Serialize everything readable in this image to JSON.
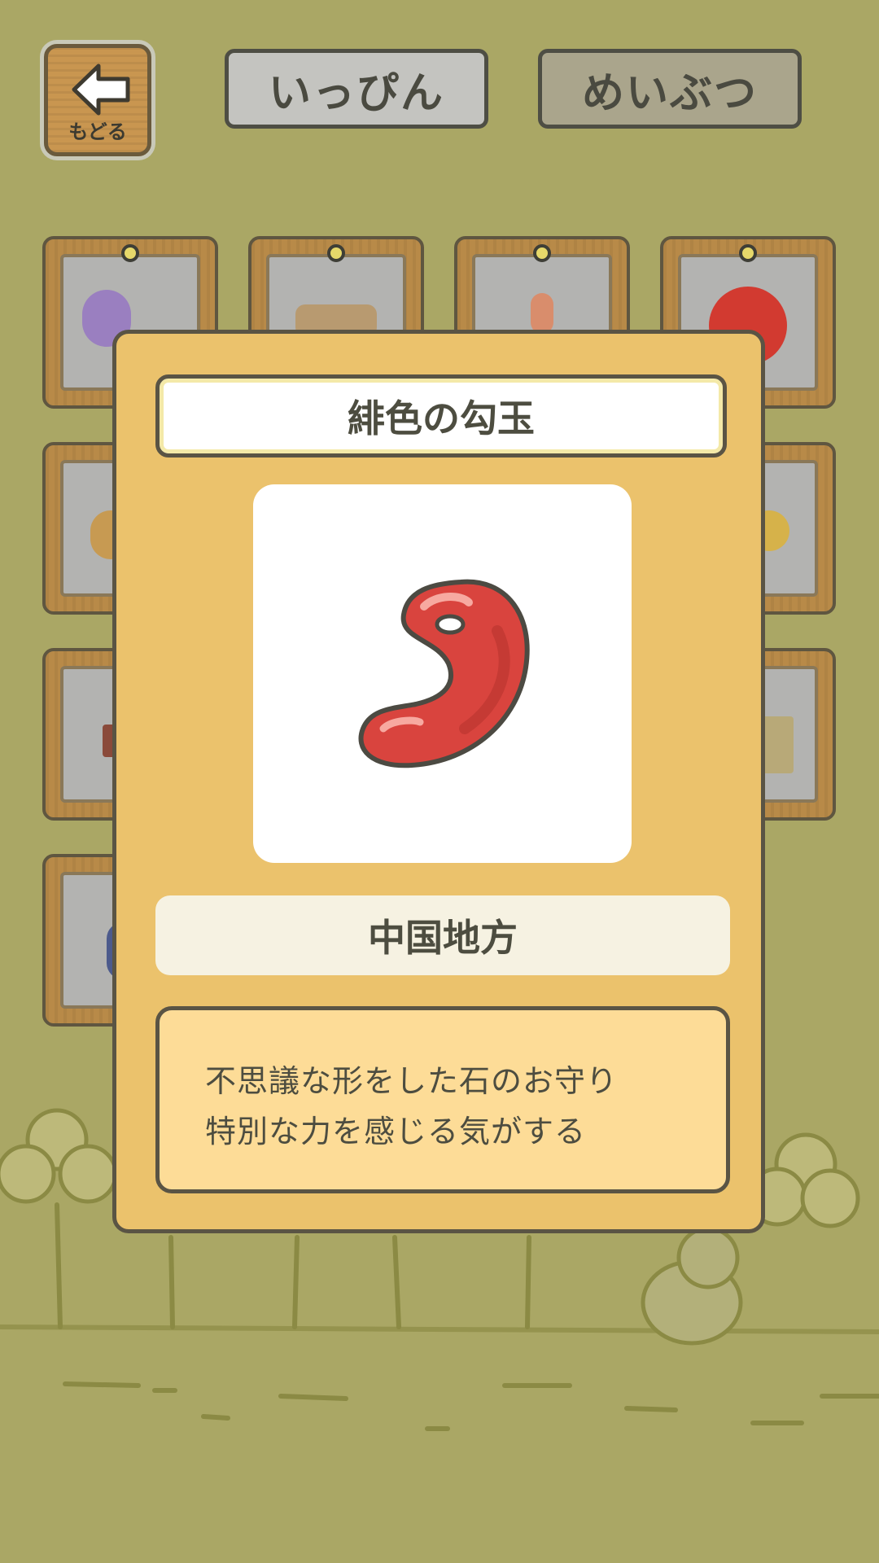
{
  "header": {
    "back_label": "もどる",
    "tabs": [
      {
        "label": "いっぴん"
      },
      {
        "label": "めいぶつ"
      }
    ]
  },
  "modal": {
    "title": "緋色の勾玉",
    "image_icon": "magatama-icon",
    "image_color": "#d9443e",
    "region": "中国地方",
    "description_lines": [
      "不思議な形をした石のお守り",
      "特別な力を感じる気がする"
    ]
  },
  "colors": {
    "background": "#aaa765",
    "modal": "#ebc26c",
    "desc_box": "#fddc97"
  }
}
